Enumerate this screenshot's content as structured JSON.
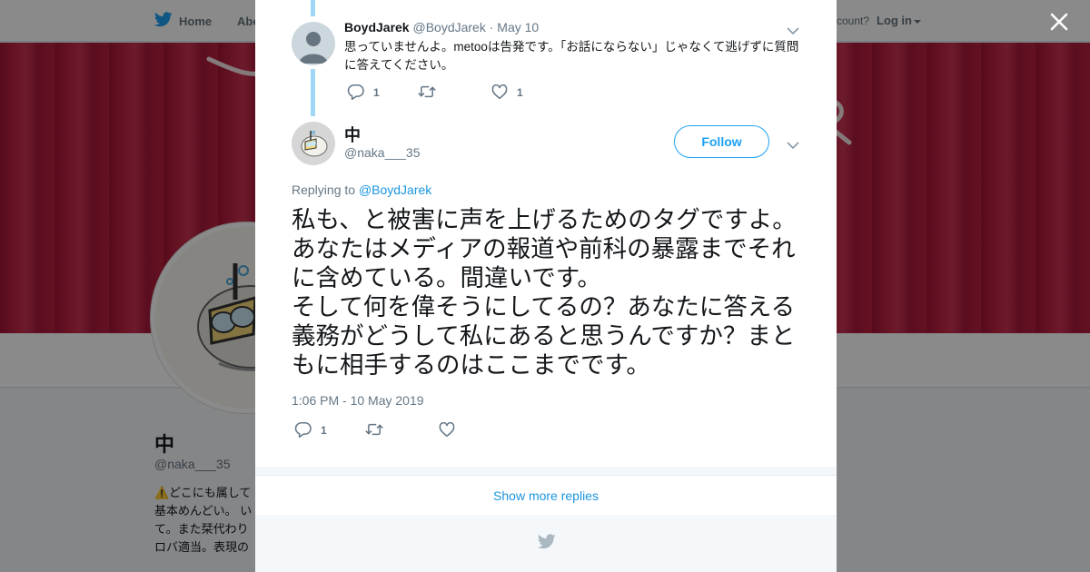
{
  "nav": {
    "home_label": "Home",
    "about_label": "Abo",
    "account_prompt": "ccount?",
    "login_label": "Log in"
  },
  "profile": {
    "name": "中",
    "handle": "@naka___35",
    "bio": "⚠️どこにも属して\n基本めんどい。 い\nて。また栞代わり\nロバ適当。表現の"
  },
  "reply_tweet": {
    "author_name": "BoydJarek",
    "author_handle": "@BoydJarek",
    "date": "May 10",
    "separator": " · ",
    "text": "思っていませんよ。metooは告発です。「お話にならない」じゃなくて逃げずに質問に答えてください。",
    "reply_count": "1",
    "retweet_count": "",
    "like_count": "1"
  },
  "main_tweet": {
    "author_name": "中",
    "author_handle": "@naka___35",
    "follow_label": "Follow",
    "replying_prefix": "Replying to",
    "replying_to": "@BoydJarek",
    "text": "私も、と被害に声を上げるためのタグですよ。あなたはメディアの報道や前科の暴露までそれに含めている。間違いです。\nそして何を偉そうにしてるの？あなたに答える義務がどうして私にあると思うんですか？まともに相手するのはここまでです。",
    "timestamp": "1:06 PM - 10 May 2019",
    "reply_count": "1",
    "retweet_count": "",
    "like_count": ""
  },
  "show_more_label": "Show more replies",
  "colors": {
    "brand_blue": "#1da1f2",
    "link_blue": "#1b95e0",
    "thread_line": "#a0d6f6",
    "banner_red": "#b9213f",
    "muted_text": "#657786"
  },
  "icons": [
    "twitter-bird-icon",
    "close-icon",
    "chevron-down-icon",
    "reply-icon",
    "retweet-icon",
    "like-icon",
    "default-avatar-icon"
  ]
}
